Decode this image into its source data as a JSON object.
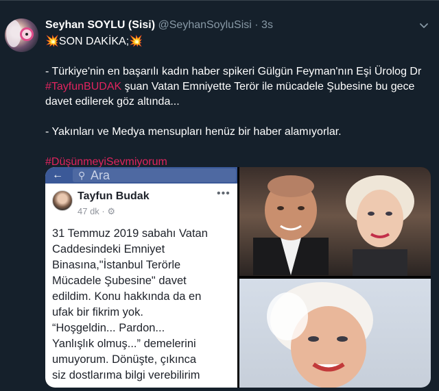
{
  "tweet": {
    "display_name": "Seyhan SOYLU (Sisi)",
    "handle": "@SeyhanSoyluSisi",
    "separator": "·",
    "time": "3s",
    "lines": [
      "💥SON DAKİKA;💥",
      "- Türkiye'nin en başarılı kadın haber spikeri Gülgün Feyman'nın Eşi Ürolog Dr",
      "#TayfunBUDAK",
      " şuan Vatan Emniyette Terör ile mücadele Şubesine bu gece",
      "davet edilerek göz altında...",
      "- Yakınları ve Medya mensupları henüz bir haber alamıyorlar.",
      "#DüşünmeyiSevmiyorum"
    ]
  },
  "icons": {
    "menu": "chevron-down-icon",
    "fb_back": "arrow-left-icon",
    "fb_search": "search-icon",
    "fb_more": "more-dots-icon"
  },
  "media": {
    "fb_search_placeholder": "Ara",
    "fb_author": "Tayfun Budak",
    "fb_meta": "47 dk · ⚙",
    "fb_more_glyph": "•••",
    "fb_post_lines": [
      "31 Temmuz 2019 sabahı Vatan",
      "Caddesindeki Emniyet",
      "Binasına,\"İstanbul Terörle",
      "Mücadele Şubesine\" davet",
      "edildim. Konu hakkında da en",
      "ufak bir fikrim yok.",
      "“Hoşgeldin... Pardon...",
      "Yanlışlık olmuş...” demelerini",
      "umuyorum. Dönüşte, çıkınca",
      "siz dostlarıma bilgi verebilirim"
    ]
  },
  "colors": {
    "background": "#15202b",
    "text": "#ffffff",
    "secondary": "#8899a6",
    "hashtag": "#e0245e",
    "facebook": "#3b5998"
  }
}
